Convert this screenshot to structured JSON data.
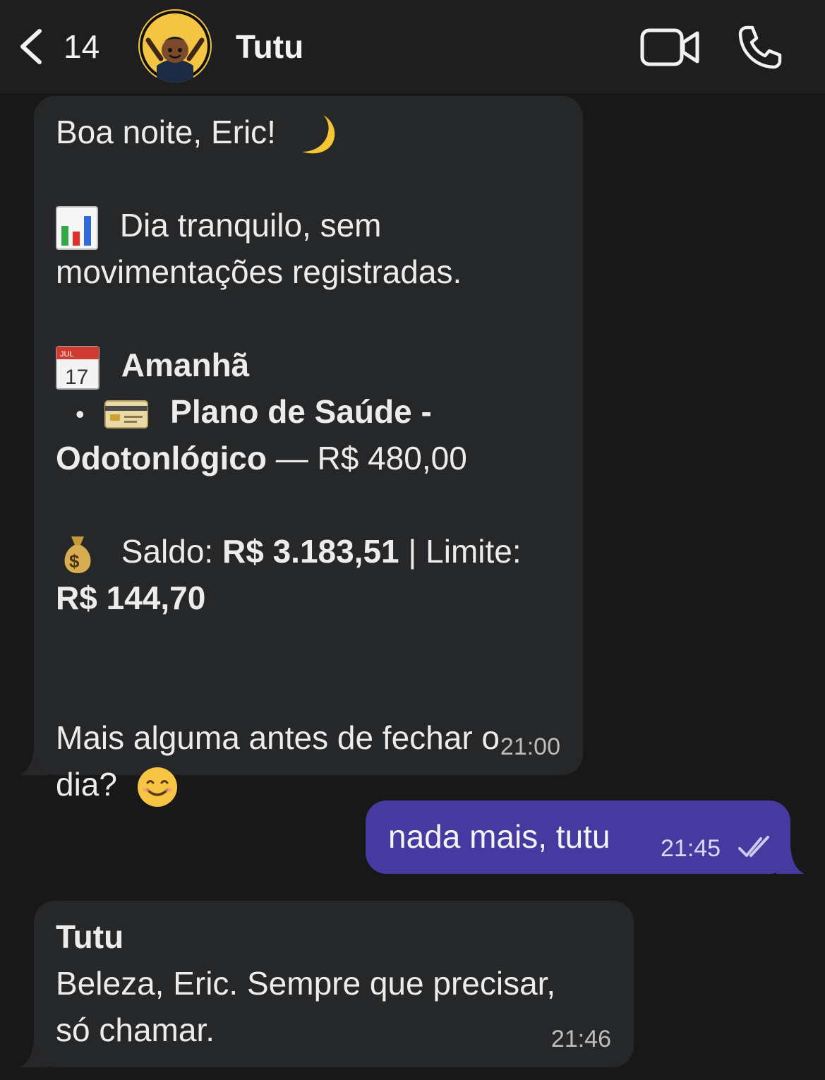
{
  "header": {
    "unread_count": "14",
    "contact_name": "Tutu"
  },
  "messages": {
    "m1": {
      "greeting": "Boa noite, Eric!",
      "day_line1": "Dia tranquilo, sem",
      "day_line2": "movimentações registradas.",
      "tomorrow_label": "Amanhã",
      "bullet": "•",
      "bill_name_part1": "Plano de Saúde -",
      "bill_name_part2": "Odotonlógico",
      "bill_sep": " — R$ 480,00",
      "saldo_label": "Saldo: ",
      "saldo_value": "R$ 3.183,51",
      "limite_label": " | Limite:",
      "limite_value": "R$ 144,70",
      "closing_line1": "Mais alguma antes de fechar o",
      "closing_line2": "dia?",
      "time": "21:00"
    },
    "m2": {
      "text": "nada mais, tutu",
      "time": "21:45"
    },
    "m3": {
      "sender": "Tutu",
      "line1": "Beleza, Eric. Sempre que precisar,",
      "line2": "só chamar.",
      "time": "21:46"
    }
  },
  "colors": {
    "background": "#181818",
    "incoming_bubble": "#262728",
    "outgoing_bubble": "#463aa1"
  },
  "icons": [
    "chevron-left-icon",
    "video-camera-icon",
    "phone-icon",
    "moon-emoji",
    "bar-chart-emoji",
    "calendar-emoji",
    "credit-card-emoji",
    "money-bag-emoji",
    "smiling-face-emoji",
    "double-check-icon"
  ]
}
